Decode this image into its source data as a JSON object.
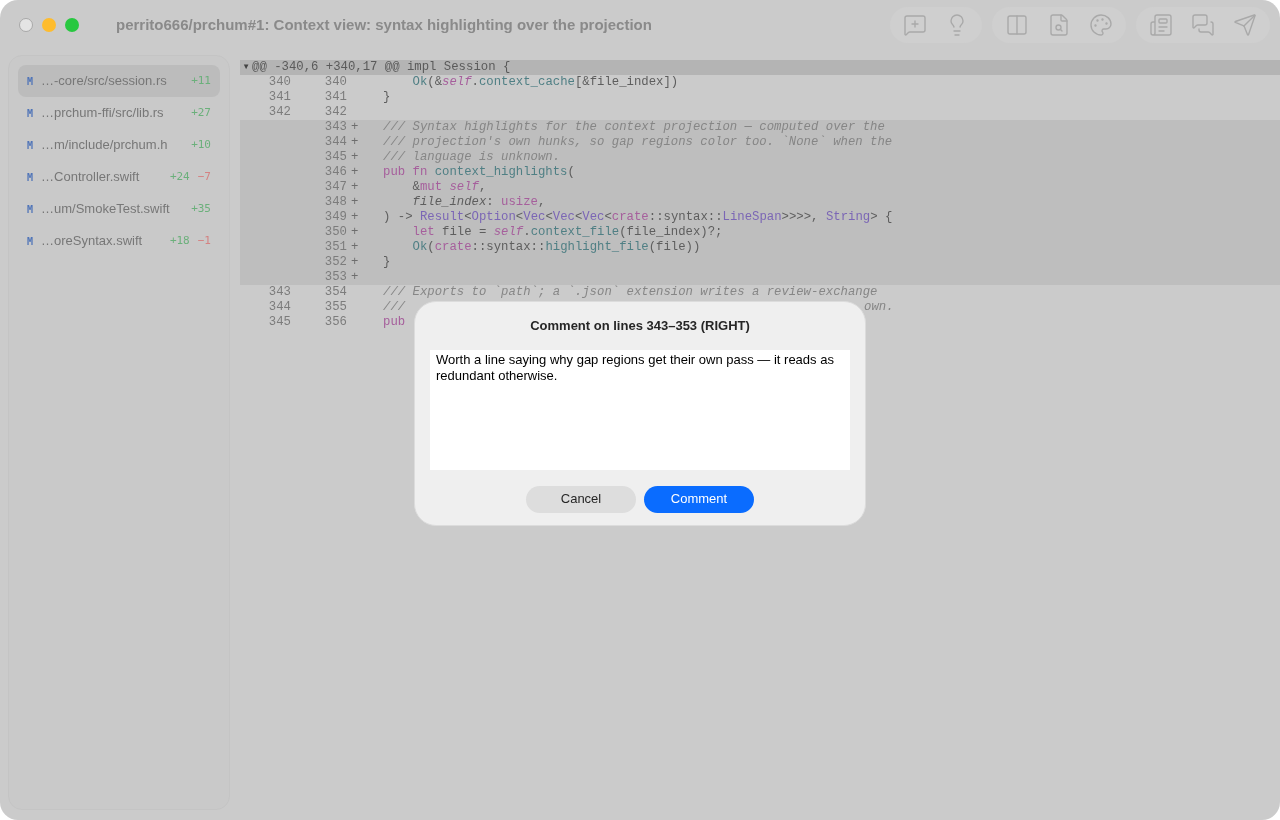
{
  "window": {
    "title": "perrito666/prchum#1: Context view: syntax highlighting over the projection",
    "traffic_lights": [
      {
        "kind": "close",
        "disabled": true
      },
      {
        "kind": "minimize",
        "disabled": false
      },
      {
        "kind": "zoom",
        "disabled": false
      }
    ]
  },
  "files": [
    {
      "status": "M",
      "path": "…-core/src/session.rs",
      "additions": "+11",
      "selected": true
    },
    {
      "status": "M",
      "path": "…prchum-ffi/src/lib.rs",
      "additions": "+27",
      "selected": false
    },
    {
      "status": "M",
      "path": "…m/include/prchum.h",
      "additions": "+10",
      "selected": false
    },
    {
      "status": "M",
      "path": "…Controller.swift",
      "additions": "+24",
      "deletions": "−7",
      "selected": false
    },
    {
      "status": "M",
      "path": "…um/SmokeTest.swift",
      "additions": "+35",
      "selected": false
    },
    {
      "status": "M",
      "path": "…oreSyntax.swift",
      "additions": "+18",
      "deletions": "−1",
      "selected": false
    }
  ],
  "hunk": {
    "toggle": "▾",
    "header": "@@ -340,6 +340,17 @@ impl Session {",
    "expanded": true
  },
  "lines": [
    {
      "kind": "context",
      "old": "340",
      "new": "340",
      "tokens": [
        {
          "text": "    Ok",
          "kind": "func"
        },
        {
          "text": "(&",
          "kind": "plain"
        },
        {
          "text": "self",
          "kind": "self"
        },
        {
          "text": ".",
          "kind": "plain"
        },
        {
          "text": "context_cache",
          "kind": "func"
        },
        {
          "text": "[&file_index])",
          "kind": "plain"
        }
      ]
    },
    {
      "kind": "context",
      "old": "341",
      "new": "341",
      "tokens": [
        {
          "text": "}",
          "kind": "plain"
        }
      ]
    },
    {
      "kind": "context",
      "old": "342",
      "new": "342"
    },
    {
      "kind": "added",
      "new": "343",
      "sign": "+",
      "tokens": [
        {
          "text": "/// Syntax highlights for the context projection — computed over the",
          "kind": "comment"
        }
      ]
    },
    {
      "kind": "added",
      "new": "344",
      "sign": "+",
      "tokens": [
        {
          "text": "/// projection's own hunks, so gap regions color too. `None` when the",
          "kind": "comment"
        }
      ]
    },
    {
      "kind": "added",
      "new": "345",
      "sign": "+",
      "tokens": [
        {
          "text": "/// language is unknown.",
          "kind": "comment"
        }
      ]
    },
    {
      "kind": "added",
      "new": "346",
      "sign": "+",
      "tokens": [
        {
          "text": "pub fn ",
          "kind": "keyword"
        },
        {
          "text": "context_highlights",
          "kind": "func"
        },
        {
          "text": "(",
          "kind": "plain"
        }
      ]
    },
    {
      "kind": "added",
      "new": "347",
      "sign": "+",
      "tokens": [
        {
          "text": "    &",
          "kind": "plain"
        },
        {
          "text": "mut ",
          "kind": "keyword"
        },
        {
          "text": "self",
          "kind": "self"
        },
        {
          "text": ",",
          "kind": "plain"
        }
      ]
    },
    {
      "kind": "added",
      "new": "348",
      "sign": "+",
      "tokens": [
        {
          "text": "    file_index",
          "kind": "param"
        },
        {
          "text": ": ",
          "kind": "plain"
        },
        {
          "text": "usize",
          "kind": "keyword"
        },
        {
          "text": ",",
          "kind": "plain"
        }
      ]
    },
    {
      "kind": "added",
      "new": "349",
      "sign": "+",
      "tokens": [
        {
          "text": ") -> ",
          "kind": "plain"
        },
        {
          "text": "Result",
          "kind": "type"
        },
        {
          "text": "<",
          "kind": "plain"
        },
        {
          "text": "Option",
          "kind": "type"
        },
        {
          "text": "<",
          "kind": "plain"
        },
        {
          "text": "Vec",
          "kind": "type"
        },
        {
          "text": "<",
          "kind": "plain"
        },
        {
          "text": "Vec",
          "kind": "type"
        },
        {
          "text": "<",
          "kind": "plain"
        },
        {
          "text": "Vec",
          "kind": "type"
        },
        {
          "text": "<",
          "kind": "plain"
        },
        {
          "text": "crate",
          "kind": "keyword"
        },
        {
          "text": "::syntax::",
          "kind": "plain"
        },
        {
          "text": "LineSpan",
          "kind": "type"
        },
        {
          "text": ">>>>, ",
          "kind": "plain"
        },
        {
          "text": "String",
          "kind": "type"
        },
        {
          "text": "> {",
          "kind": "plain"
        }
      ]
    },
    {
      "kind": "added",
      "new": "350",
      "sign": "+",
      "tokens": [
        {
          "text": "    let",
          "kind": "keyword"
        },
        {
          "text": " file = ",
          "kind": "plain"
        },
        {
          "text": "self",
          "kind": "self"
        },
        {
          "text": ".",
          "kind": "plain"
        },
        {
          "text": "context_file",
          "kind": "func"
        },
        {
          "text": "(file_index)?;",
          "kind": "plain"
        }
      ]
    },
    {
      "kind": "added",
      "new": "351",
      "sign": "+",
      "tokens": [
        {
          "text": "    Ok",
          "kind": "func"
        },
        {
          "text": "(",
          "kind": "plain"
        },
        {
          "text": "crate",
          "kind": "keyword"
        },
        {
          "text": "::syntax::",
          "kind": "plain"
        },
        {
          "text": "highlight_file",
          "kind": "func"
        },
        {
          "text": "(file))",
          "kind": "plain"
        }
      ]
    },
    {
      "kind": "added",
      "new": "352",
      "sign": "+",
      "tokens": [
        {
          "text": "}",
          "kind": "plain"
        }
      ]
    },
    {
      "kind": "added",
      "new": "353",
      "sign": "+"
    },
    {
      "kind": "context",
      "old": "343",
      "new": "354",
      "tokens": [
        {
          "text": "/// Exports to `path`; a `.json` extension writes a review-exchange",
          "kind": "comment"
        }
      ]
    },
    {
      "kind": "context",
      "old": "344",
      "new": "355",
      "tokens": [
        {
          "text": "///",
          "kind": "comment"
        }
      ],
      "tail": [
        {
          "text": "own.",
          "kind": "comment"
        }
      ]
    },
    {
      "kind": "context",
      "old": "345",
      "new": "356",
      "tokens": [
        {
          "text": "pub",
          "kind": "keyword"
        }
      ]
    }
  ],
  "dialog": {
    "title": "Comment on lines 343–353 (RIGHT)",
    "value": "Worth a line saying why gap regions get their own pass — it reads as redundant otherwise.",
    "buttons": [
      {
        "label": "Cancel",
        "kind": "secondary"
      },
      {
        "label": "Comment",
        "kind": "primary"
      }
    ]
  }
}
